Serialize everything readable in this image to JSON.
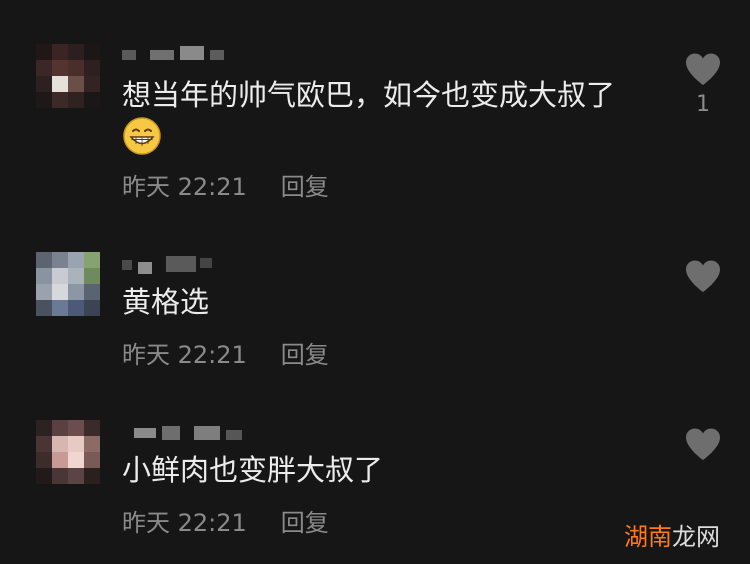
{
  "comments": [
    {
      "text": "想当年的帅气欧巴，如今也变成大叔了",
      "emoji": "grinning-face-emoji",
      "time": "昨天 22:21",
      "reply_label": "回复",
      "like_count": "1"
    },
    {
      "text": "黄格选",
      "time": "昨天 22:21",
      "reply_label": "回复",
      "like_count": ""
    },
    {
      "text": "小鲜肉也变胖大叔了",
      "time": "昨天 22:21",
      "reply_label": "回复",
      "like_count": ""
    }
  ],
  "watermark": {
    "part1": "湖南",
    "part2": "龙网"
  },
  "colors": {
    "background": "#161616",
    "text": "#ececec",
    "muted": "#8a8a8a",
    "heart": "#6e6e6e",
    "watermark_accent": "#ff7a1a"
  },
  "icons": {
    "like": "heart-icon",
    "emoji": "grinning-face-emoji"
  }
}
